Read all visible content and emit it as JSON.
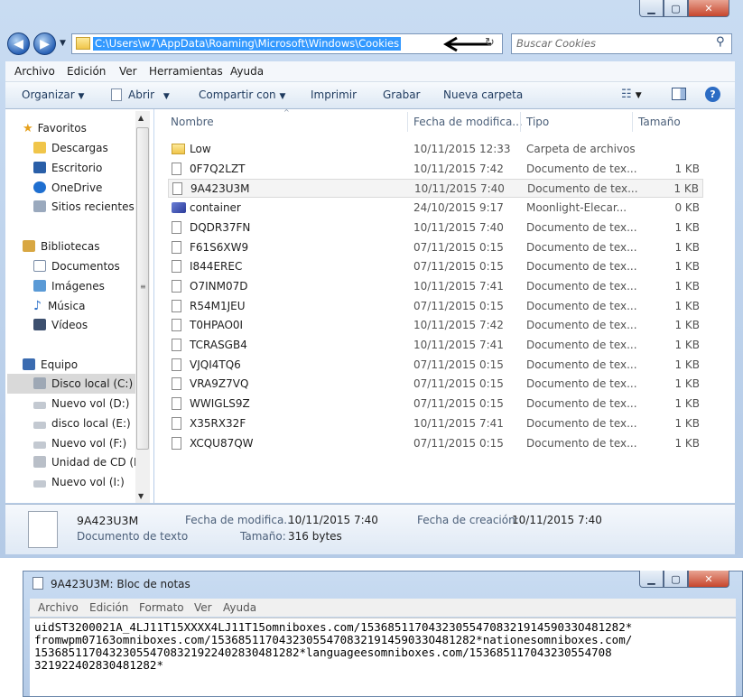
{
  "explorer": {
    "address_path": "C:\\Users\\w7\\AppData\\Roaming\\Microsoft\\Windows\\Cookies",
    "search_placeholder": "Buscar Cookies",
    "menu": [
      "Archivo",
      "Edición",
      "Ver",
      "Herramientas",
      "Ayuda"
    ],
    "toolbar": {
      "organize": "Organizar",
      "open": "Abrir",
      "share": "Compartir con",
      "print": "Imprimir",
      "burn": "Grabar",
      "new_folder": "Nueva carpeta"
    },
    "nav": {
      "favorites": "Favoritos",
      "favorite_items": [
        "Descargas",
        "Escritorio",
        "OneDrive",
        "Sitios recientes"
      ],
      "libraries": "Bibliotecas",
      "library_items": [
        "Documentos",
        "Imágenes",
        "Música",
        "Vídeos"
      ],
      "computer": "Equipo",
      "drives": [
        "Disco local (C:)",
        "Nuevo vol (D:)",
        "disco local (E:)",
        "Nuevo vol (F:)",
        "Unidad de CD (H",
        "Nuevo vol (I:)"
      ]
    },
    "columns": {
      "name": "Nombre",
      "date": "Fecha de modifica...",
      "type": "Tipo",
      "size": "Tamaño"
    },
    "files": [
      {
        "name": "Low",
        "date": "10/11/2015 12:33",
        "type": "Carpeta de archivos",
        "size": "",
        "icon": "folder-icon"
      },
      {
        "name": "0F7Q2LZT",
        "date": "10/11/2015 7:42",
        "type": "Documento de tex...",
        "size": "1 KB",
        "icon": "text-file-icon"
      },
      {
        "name": "9A423U3M",
        "date": "10/11/2015 7:40",
        "type": "Documento de tex...",
        "size": "1 KB",
        "icon": "text-file-icon"
      },
      {
        "name": "container",
        "date": "24/10/2015 9:17",
        "type": "Moonlight-Elecar...",
        "size": "0 KB",
        "icon": "container-file-icon"
      },
      {
        "name": "DQDR37FN",
        "date": "10/11/2015 7:40",
        "type": "Documento de tex...",
        "size": "1 KB",
        "icon": "text-file-icon"
      },
      {
        "name": "F61S6XW9",
        "date": "07/11/2015 0:15",
        "type": "Documento de tex...",
        "size": "1 KB",
        "icon": "text-file-icon"
      },
      {
        "name": "I844EREC",
        "date": "07/11/2015 0:15",
        "type": "Documento de tex...",
        "size": "1 KB",
        "icon": "text-file-icon"
      },
      {
        "name": "O7INM07D",
        "date": "10/11/2015 7:41",
        "type": "Documento de tex...",
        "size": "1 KB",
        "icon": "text-file-icon"
      },
      {
        "name": "R54M1JEU",
        "date": "07/11/2015 0:15",
        "type": "Documento de tex...",
        "size": "1 KB",
        "icon": "text-file-icon"
      },
      {
        "name": "T0HPAO0I",
        "date": "10/11/2015 7:42",
        "type": "Documento de tex...",
        "size": "1 KB",
        "icon": "text-file-icon"
      },
      {
        "name": "TCRASGB4",
        "date": "10/11/2015 7:41",
        "type": "Documento de tex...",
        "size": "1 KB",
        "icon": "text-file-icon"
      },
      {
        "name": "VJQI4TQ6",
        "date": "07/11/2015 0:15",
        "type": "Documento de tex...",
        "size": "1 KB",
        "icon": "text-file-icon"
      },
      {
        "name": "VRA9Z7VQ",
        "date": "07/11/2015 0:15",
        "type": "Documento de tex...",
        "size": "1 KB",
        "icon": "text-file-icon"
      },
      {
        "name": "WWIGLS9Z",
        "date": "07/11/2015 0:15",
        "type": "Documento de tex...",
        "size": "1 KB",
        "icon": "text-file-icon"
      },
      {
        "name": "X35RX32F",
        "date": "10/11/2015 7:41",
        "type": "Documento de tex...",
        "size": "1 KB",
        "icon": "text-file-icon"
      },
      {
        "name": "XCQU87QW",
        "date": "07/11/2015 0:15",
        "type": "Documento de tex...",
        "size": "1 KB",
        "icon": "text-file-icon"
      }
    ],
    "selected_file": "9A423U3M",
    "details": {
      "name": "9A423U3M",
      "modified_label": "Fecha de modifica...",
      "modified_value": "10/11/2015 7:40",
      "created_label": "Fecha de creación:",
      "created_value": "10/11/2015 7:40",
      "kind": "Documento de texto",
      "size_label": "Tamaño:",
      "size_value": "316 bytes"
    }
  },
  "notepad": {
    "title": "9A423U3M: Bloc de notas",
    "menu": [
      "Archivo",
      "Edición",
      "Formato",
      "Ver",
      "Ayuda"
    ],
    "lines": [
      "uidST3200021A_4LJ11T15XXXX4LJ11T15omniboxes.com/15368511704323055470832191459033O481282*",
      "fromwpm07163omniboxes.com/15368511704323055470832191459033O481282*nationesomniboxes.com/",
      "1536851170432305547083219224028304812​82*languageesomniboxes.com/153685117043230554708",
      "32192240283048128​2*"
    ]
  },
  "colors": {
    "selection": "#3399ff",
    "titlebar": "#b9d1ea",
    "close": "#c7462c"
  }
}
